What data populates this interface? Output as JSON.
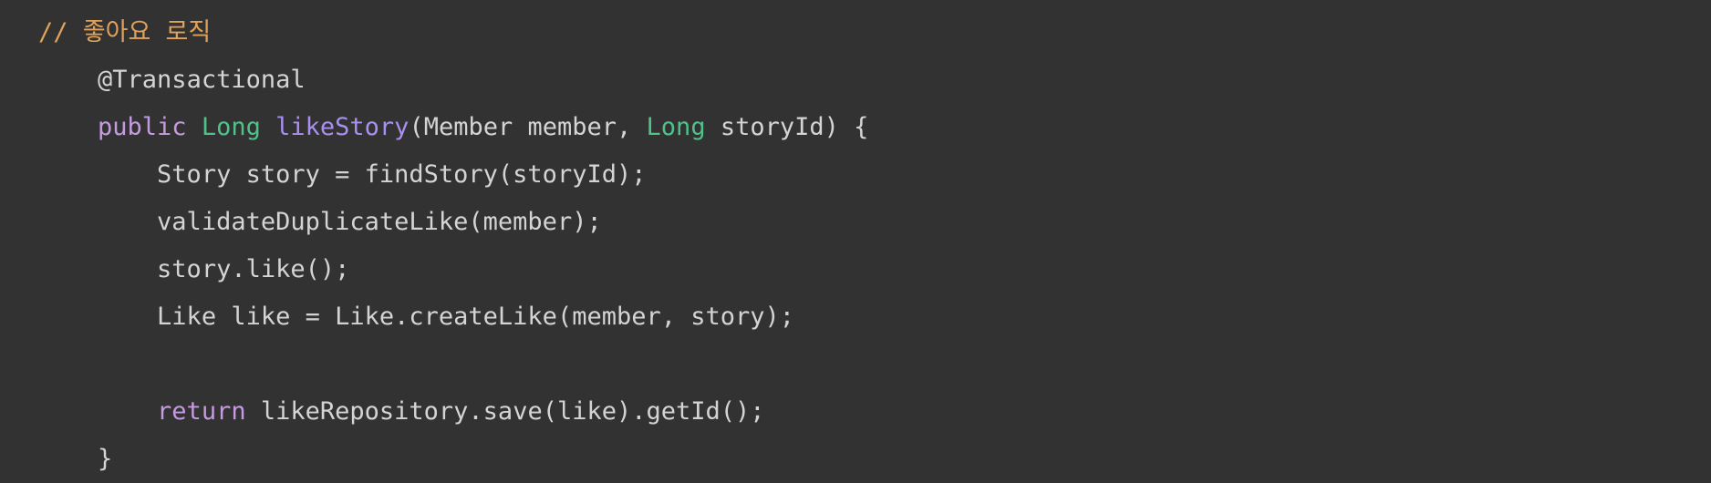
{
  "editor": {
    "background": "#323232",
    "colors": {
      "plain": "#d4d4d4",
      "comment": "#e0a25a",
      "keyword": "#c59ae0",
      "type": "#4fc28a",
      "method": "#a88ff0"
    }
  },
  "code_lines": [
    {
      "indent": "",
      "tokens": [
        {
          "kind": "comment",
          "text": "// 좋아요 로직"
        }
      ]
    },
    {
      "indent": "    ",
      "tokens": [
        {
          "kind": "plain",
          "text": "@Transactional"
        }
      ]
    },
    {
      "indent": "    ",
      "tokens": [
        {
          "kind": "keyword",
          "text": "public"
        },
        {
          "kind": "plain",
          "text": " "
        },
        {
          "kind": "type",
          "text": "Long"
        },
        {
          "kind": "plain",
          "text": " "
        },
        {
          "kind": "method",
          "text": "likeStory"
        },
        {
          "kind": "plain",
          "text": "(Member member, "
        },
        {
          "kind": "type",
          "text": "Long"
        },
        {
          "kind": "plain",
          "text": " storyId) {"
        }
      ]
    },
    {
      "indent": "        ",
      "tokens": [
        {
          "kind": "plain",
          "text": "Story story = findStory(storyId);"
        }
      ]
    },
    {
      "indent": "        ",
      "tokens": [
        {
          "kind": "plain",
          "text": "validateDuplicateLike(member);"
        }
      ]
    },
    {
      "indent": "        ",
      "tokens": [
        {
          "kind": "plain",
          "text": "story.like();"
        }
      ]
    },
    {
      "indent": "        ",
      "tokens": [
        {
          "kind": "plain",
          "text": "Like like = Like.createLike(member, story);"
        }
      ]
    },
    {
      "indent": "",
      "tokens": []
    },
    {
      "indent": "        ",
      "tokens": [
        {
          "kind": "keyword",
          "text": "return"
        },
        {
          "kind": "plain",
          "text": " likeRepository.save(like).getId();"
        }
      ]
    },
    {
      "indent": "    ",
      "tokens": [
        {
          "kind": "plain",
          "text": "}"
        }
      ]
    }
  ]
}
